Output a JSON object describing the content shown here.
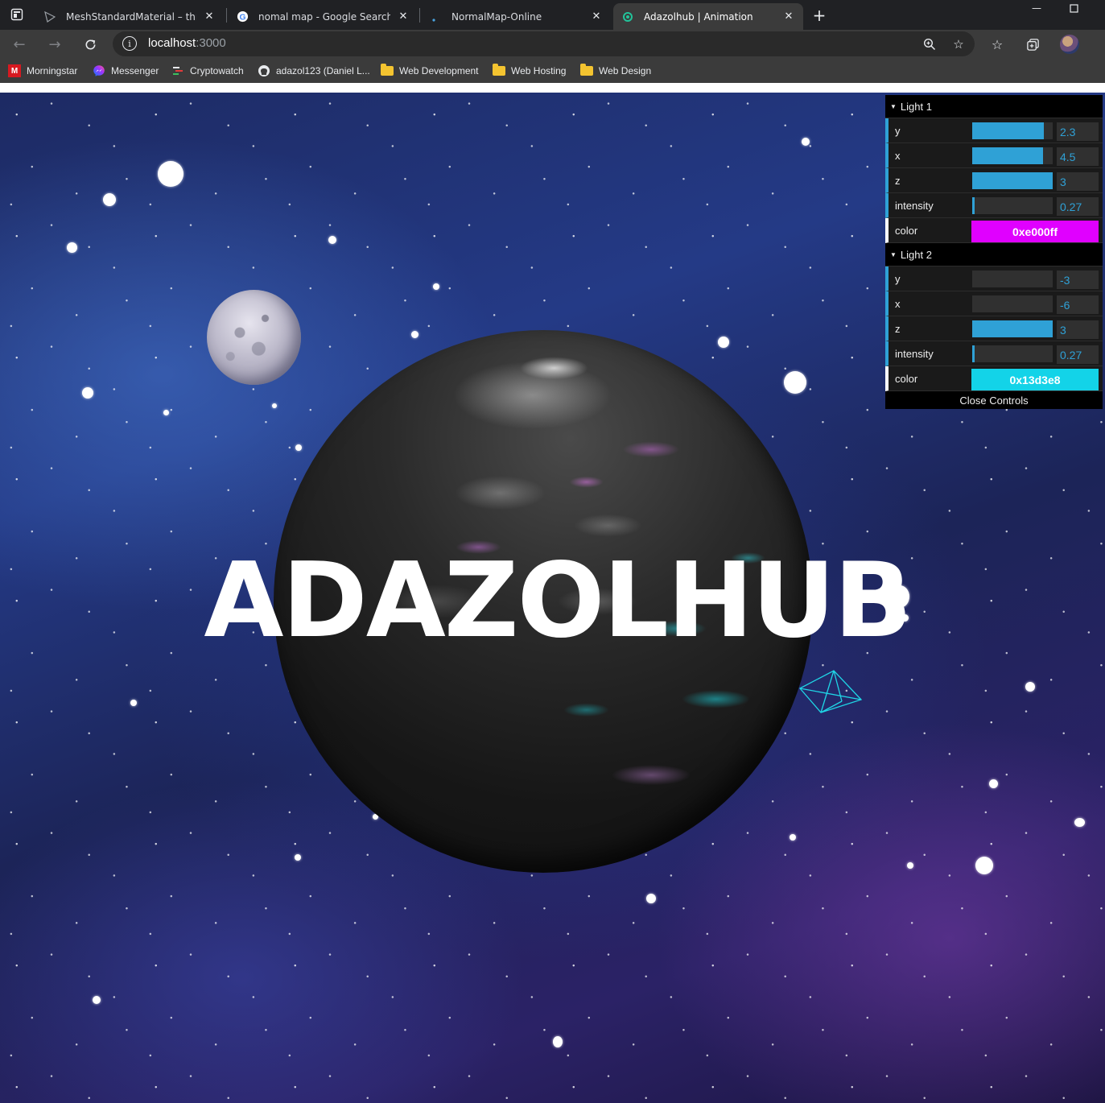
{
  "browser": {
    "tabs": [
      {
        "title": "MeshStandardMaterial – three.js",
        "icon": "threejs-icon"
      },
      {
        "title": "nomal map - Google Search",
        "icon": "google-icon"
      },
      {
        "title": "NormalMap-Online",
        "icon": "dot-icon"
      },
      {
        "title": "Adazolhub | Animation",
        "icon": "react-icon",
        "active": true
      }
    ],
    "url_host": "localhost",
    "url_port": ":3000"
  },
  "bookmarks": [
    {
      "label": "Morningstar",
      "icon": "morningstar-icon"
    },
    {
      "label": "Messenger",
      "icon": "messenger-icon"
    },
    {
      "label": "Cryptowatch",
      "icon": "cryptowatch-icon"
    },
    {
      "label": "adazol123 (Daniel L...",
      "icon": "github-icon"
    },
    {
      "label": "Web Development",
      "icon": "folder-icon"
    },
    {
      "label": "Web Hosting",
      "icon": "folder-icon"
    },
    {
      "label": "Web Design",
      "icon": "folder-icon"
    }
  ],
  "page": {
    "hero_title": "ADAZOLHUB"
  },
  "gui": {
    "light1": {
      "title": "Light 1",
      "y": {
        "label": "y",
        "value": "2.3",
        "fill": 0.89
      },
      "x": {
        "label": "x",
        "value": "4.5",
        "fill": 0.88
      },
      "z": {
        "label": "z",
        "value": "3",
        "fill": 1.0
      },
      "intensity": {
        "label": "intensity",
        "value": "0.27",
        "fill": 0.03
      },
      "color": {
        "label": "color",
        "value": "0xe000ff",
        "hex": "#e000ff"
      }
    },
    "light2": {
      "title": "Light 2",
      "y": {
        "label": "y",
        "value": "-3",
        "fill": 0.0
      },
      "x": {
        "label": "x",
        "value": "-6",
        "fill": 0.0
      },
      "z": {
        "label": "z",
        "value": "3",
        "fill": 1.0
      },
      "intensity": {
        "label": "intensity",
        "value": "0.27",
        "fill": 0.03
      },
      "color": {
        "label": "color",
        "value": "0x13d3e8",
        "hex": "#13d3e8"
      }
    },
    "close_label": "Close Controls"
  },
  "colors": {
    "gui_accent": "#2fa1d6",
    "light1": "#e000ff",
    "light2": "#13d3e8"
  }
}
